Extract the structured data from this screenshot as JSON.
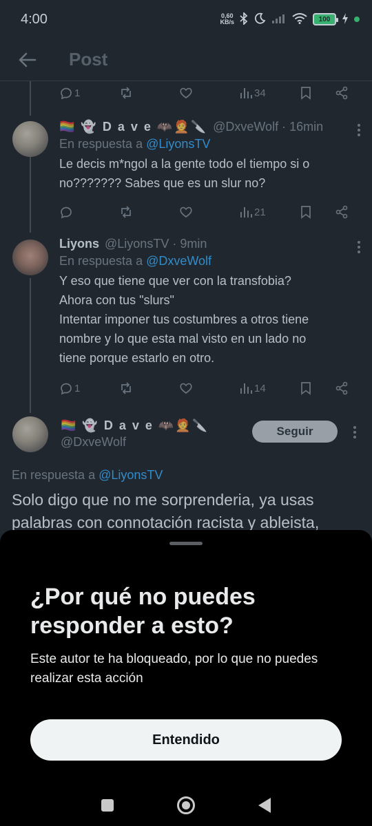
{
  "status_bar": {
    "time": "4:00",
    "net_speed_value": "0,60",
    "net_speed_unit": "KB/s",
    "battery": "100"
  },
  "header": {
    "title": "Post"
  },
  "top_actions": {
    "reply_count": "1",
    "views_count": "34"
  },
  "tweets": [
    {
      "display_name": "🏳️‍🌈 👻 D a v e 🦇🧑‍🦰🔪",
      "handle": "@DxveWolf",
      "time": "16min",
      "reply_prefix": "En respuesta a",
      "reply_handle": "@LiyonsTV",
      "text": "Le decis m*ngol a la gente todo el tiempo si o\nno??????? Sabes que es un slur no?",
      "reply_count": "",
      "views_count": "21"
    },
    {
      "display_name": "Liyons",
      "handle": "@LiyonsTV",
      "time": "9min",
      "reply_prefix": "En respuesta a",
      "reply_handle": "@DxveWolf",
      "text": "Y eso que tiene que ver con la transfobia?\nAhora con tus \"slurs\"\nIntentar imponer tus costumbres a otros tiene\nnombre y lo que esta mal visto en un lado no\ntiene porque estarlo en otro.",
      "reply_count": "1",
      "views_count": "14"
    }
  ],
  "focused": {
    "display_name": "🏳️‍🌈 👻 D a v e 🦇🧑‍🦰🔪",
    "handle": "@DxveWolf",
    "follow_label": "Seguir",
    "reply_prefix": "En respuesta a",
    "reply_handle": "@LiyonsTV",
    "text": "Solo digo que no me sorprenderia, ya usas\npalabras con connotación racista y ableista,"
  },
  "sheet": {
    "title": "¿Por qué no puedes responder a esto?",
    "description": "Este autor te ha bloqueado, por lo que no puedes realizar esta acción",
    "button_label": "Entendido"
  },
  "colors": {
    "background": "#000000",
    "link": "#1d9bf0",
    "muted": "#71767b",
    "text": "#e7e9ea"
  }
}
